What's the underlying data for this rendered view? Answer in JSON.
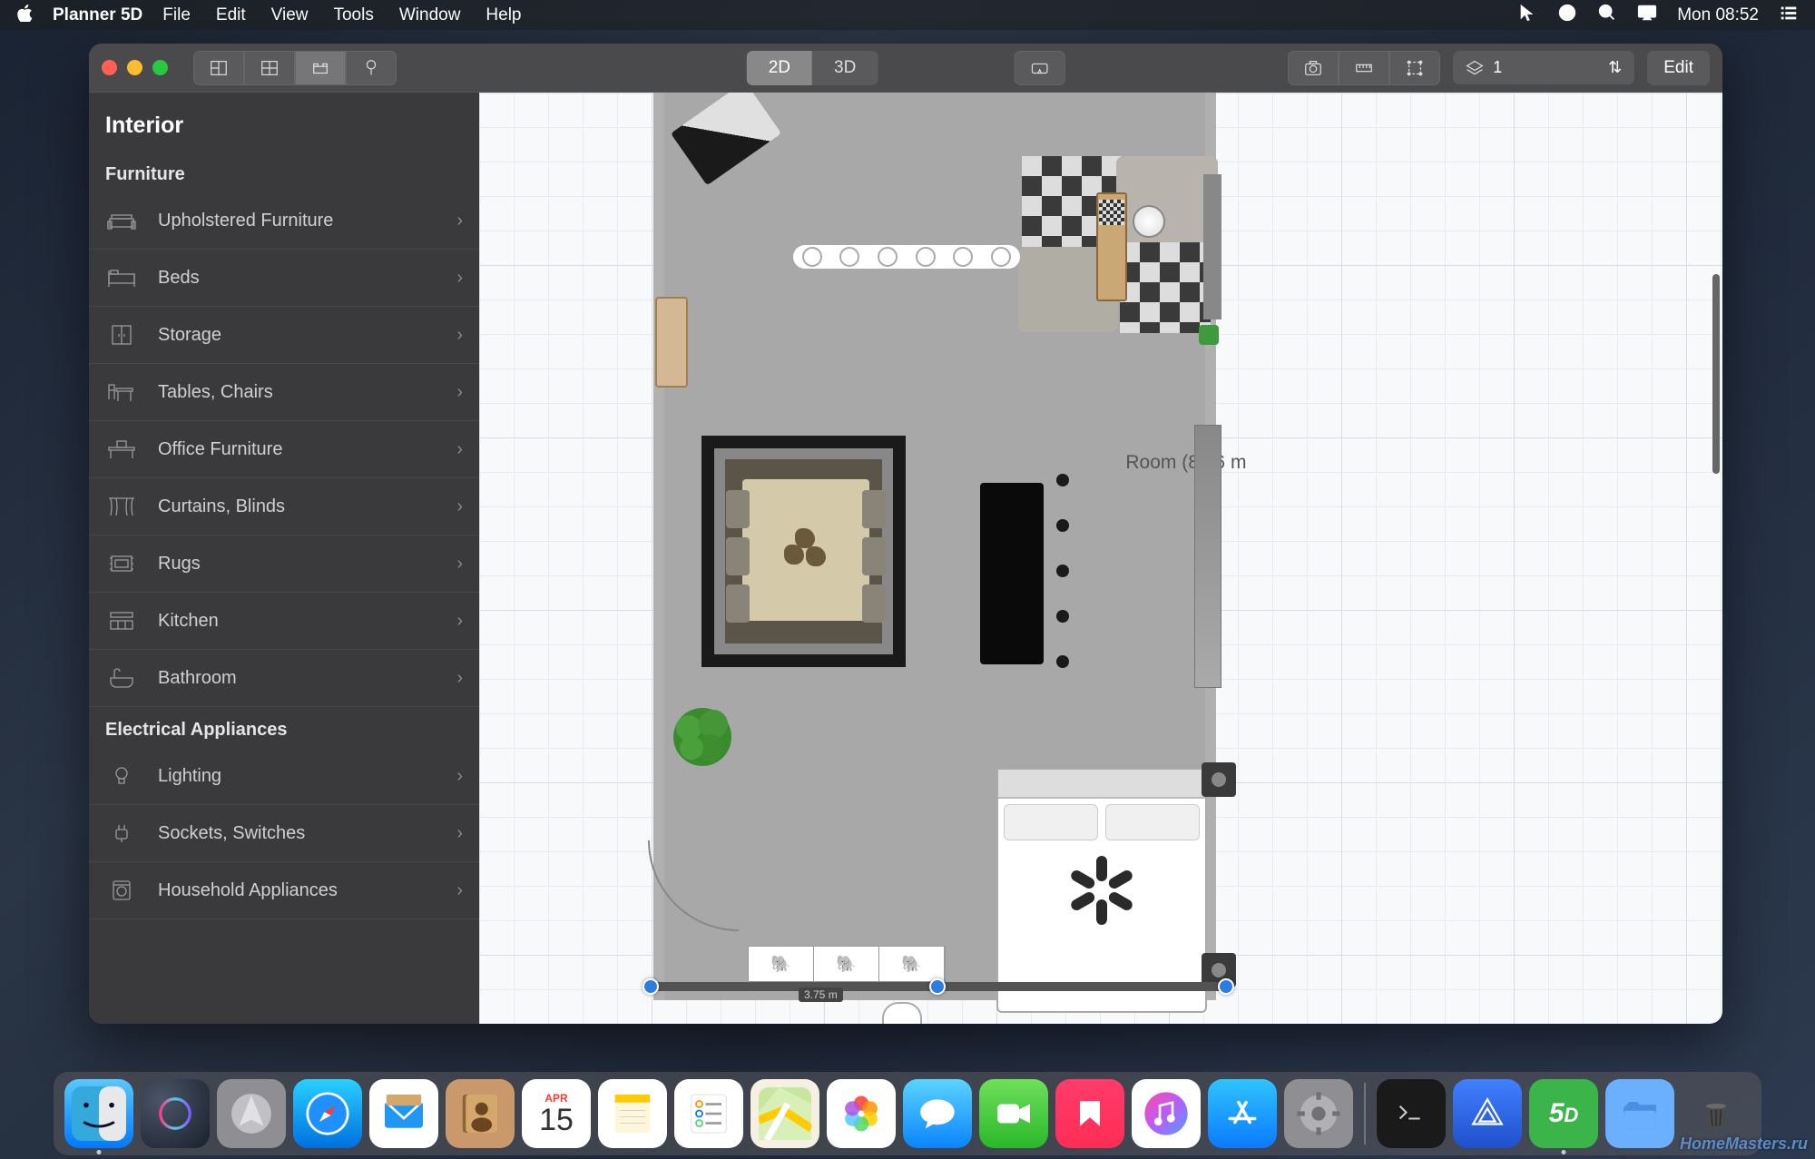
{
  "menubar": {
    "app": "Planner 5D",
    "items": [
      "File",
      "Edit",
      "View",
      "Tools",
      "Window",
      "Help"
    ],
    "clock": "Mon 08:52"
  },
  "toolbar": {
    "view2d": "2D",
    "view3d": "3D",
    "layer_label": "1",
    "edit": "Edit"
  },
  "sidebar": {
    "title": "Interior",
    "sections": [
      {
        "header": "Furniture",
        "items": [
          "Upholstered Furniture",
          "Beds",
          "Storage",
          "Tables, Chairs",
          "Office Furniture",
          "Curtains, Blinds",
          "Rugs",
          "Kitchen",
          "Bathroom"
        ]
      },
      {
        "header": "Electrical Appliances",
        "items": [
          "Lighting",
          "Sockets, Switches",
          "Household Appliances"
        ]
      }
    ]
  },
  "canvas": {
    "room_label": "Room (81.6 m",
    "wall_measure": "3.75 m"
  },
  "dock": {
    "items": [
      "finder",
      "siri",
      "launchpad",
      "safari",
      "mail",
      "contacts",
      "calendar",
      "notes",
      "reminders",
      "maps",
      "photos",
      "messages",
      "facetime",
      "news",
      "itunes",
      "appstore",
      "preferences"
    ],
    "calendar_month": "APR",
    "calendar_day": "15",
    "right_items": [
      "terminal",
      "affinity",
      "planner5d",
      "downloads",
      "trash"
    ]
  },
  "watermark": "HomeMasters.ru"
}
